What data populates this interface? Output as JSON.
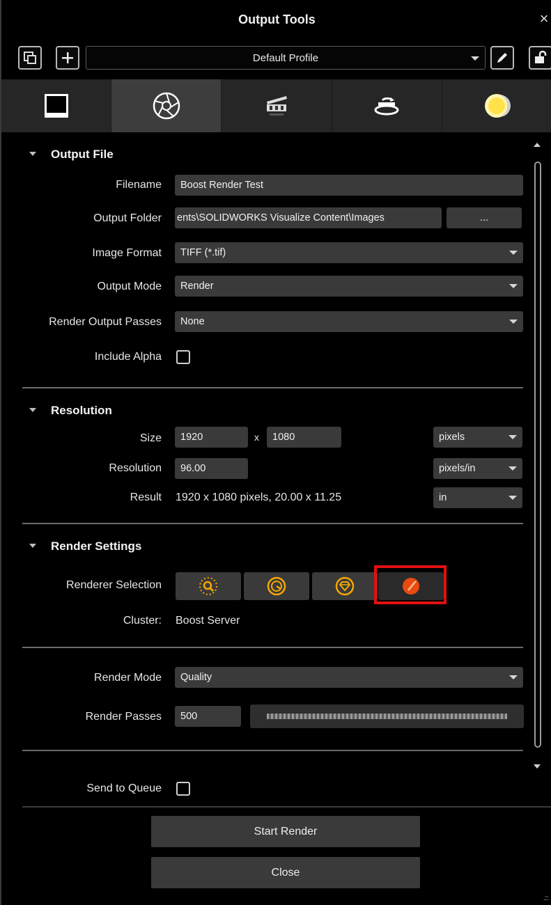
{
  "window": {
    "title": "Output Tools",
    "close_glyph": "×"
  },
  "profile": {
    "selected": "Default Profile"
  },
  "tabs": [
    {
      "icon": "frame-icon"
    },
    {
      "icon": "aperture-icon",
      "active": true
    },
    {
      "icon": "clapperboard-icon"
    },
    {
      "icon": "turntable-icon"
    },
    {
      "icon": "sun-moon-icon"
    }
  ],
  "output_file": {
    "heading": "Output File",
    "filename_label": "Filename",
    "filename_value": "Boost Render Test",
    "folder_label": "Output Folder",
    "folder_value": "ents\\SOLIDWORKS Visualize Content\\Images",
    "browse_label": "...",
    "format_label": "Image Format",
    "format_value": "TIFF (*.tif)",
    "mode_label": "Output Mode",
    "mode_value": "Render",
    "passes_label": "Render Output Passes",
    "passes_value": "None",
    "alpha_label": "Include Alpha",
    "alpha_checked": false
  },
  "resolution": {
    "heading": "Resolution",
    "size_label": "Size",
    "width": "1920",
    "by": "x",
    "height": "1080",
    "size_unit": "pixels",
    "res_label": "Resolution",
    "res_value": "96.00",
    "res_unit": "pixels/in",
    "result_label": "Result",
    "result_value": "1920 x 1080 pixels, 20.00 x 11.25",
    "result_unit": "in"
  },
  "render_settings": {
    "heading": "Render Settings",
    "renderer_label": "Renderer Selection",
    "renderers": [
      {
        "icon": "preview-renderer-icon"
      },
      {
        "icon": "fast-renderer-icon"
      },
      {
        "icon": "accurate-renderer-icon"
      },
      {
        "icon": "boost-renderer-icon",
        "selected": true
      }
    ],
    "cluster_label": "Cluster:",
    "cluster_value": "Boost Server",
    "mode_label": "Render Mode",
    "mode_value": "Quality",
    "passes_label": "Render Passes",
    "passes_value": "500"
  },
  "queue": {
    "label": "Send to Queue",
    "checked": false
  },
  "actions": {
    "start": "Start Render",
    "close": "Close"
  },
  "colors": {
    "highlight": "#e01010",
    "renderer_orange": "#f5a800",
    "boost_red": "#e84a10"
  }
}
